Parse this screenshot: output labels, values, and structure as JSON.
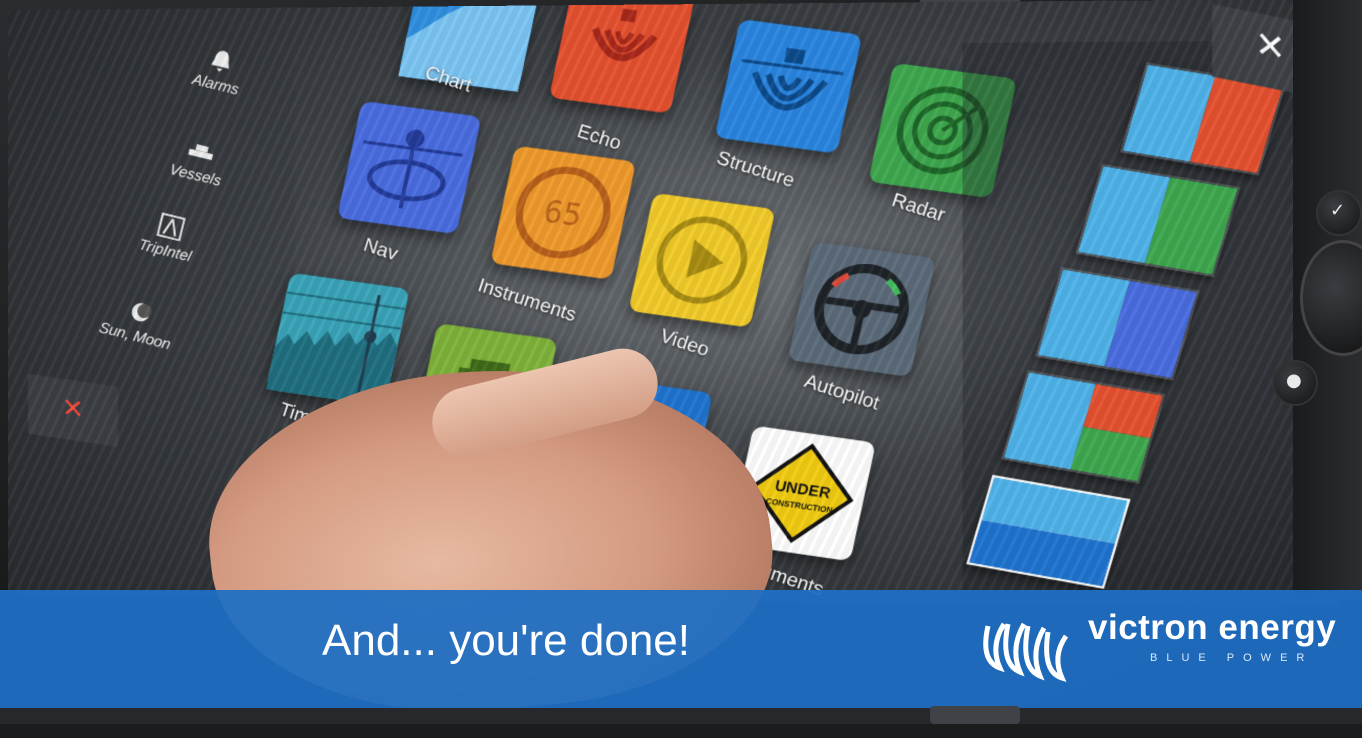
{
  "sidebar": {
    "items": [
      {
        "label": "Alarms",
        "icon": "bell-icon"
      },
      {
        "label": "Vessels",
        "icon": "vessels-icon"
      },
      {
        "label": "TripIntel",
        "icon": "compass-icon"
      },
      {
        "label": "Sun, Moon",
        "icon": "sun-moon-icon"
      }
    ]
  },
  "apps": [
    {
      "label": "Chart",
      "color": "#2f8fe0",
      "icon": "chart-icon"
    },
    {
      "label": "Echo",
      "color": "#e5512f",
      "icon": "echo-icon"
    },
    {
      "label": "Structure",
      "color": "#2a86e0",
      "icon": "structure-icon"
    },
    {
      "label": "Radar",
      "color": "#3fa84f",
      "icon": "radar-icon"
    },
    {
      "label": "Nav",
      "color": "#4a6de0",
      "icon": "nav-icon"
    },
    {
      "label": "Instruments",
      "color": "#f09a2c",
      "icon": "gauge-icon"
    },
    {
      "label": "Video",
      "color": "#f2cc2a",
      "icon": "play-icon"
    },
    {
      "label": "Autopilot",
      "color": "#5c6b7a",
      "icon": "steering-wheel-icon"
    },
    {
      "label": "Time Plot",
      "color": "#3aa4b8",
      "icon": "timeplot-icon"
    },
    {
      "label": "",
      "color": "#7fb33a",
      "icon": "boat-icon"
    },
    {
      "label": "",
      "color": "#1f74d0",
      "icon": "victron-icon"
    },
    {
      "label": "Instruments",
      "color": "#ffffff",
      "icon": "under-construction-icon"
    }
  ],
  "gauge_value": "65",
  "under_construction": {
    "line1": "UNDER",
    "line2": "CONSTRUCTION"
  },
  "close_icon": "close-icon",
  "caption": "And... you're done!",
  "brand": {
    "name": "victron energy",
    "tagline": "BLUE POWER",
    "color": "#1f6ec3"
  }
}
